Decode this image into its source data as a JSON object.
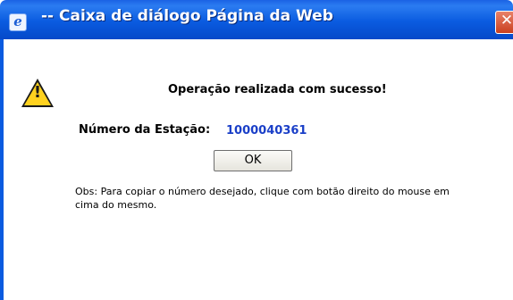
{
  "window": {
    "title": "-- Caixa de diálogo Página da Web",
    "icon": "ie-icon",
    "close_symbol": "✕"
  },
  "dialog": {
    "warning_icon": "warning-icon",
    "message": "Operação realizada com sucesso!",
    "station_label": "Número da Estação:",
    "station_number": "1000040361",
    "ok_label": "OK",
    "note": "Obs: Para copiar o número desejado, clique com botão direito do mouse em cima do mesmo."
  },
  "colors": {
    "titlebar": "#0a5be0",
    "station_number": "#1a3fc8",
    "close_button": "#c9401f"
  }
}
